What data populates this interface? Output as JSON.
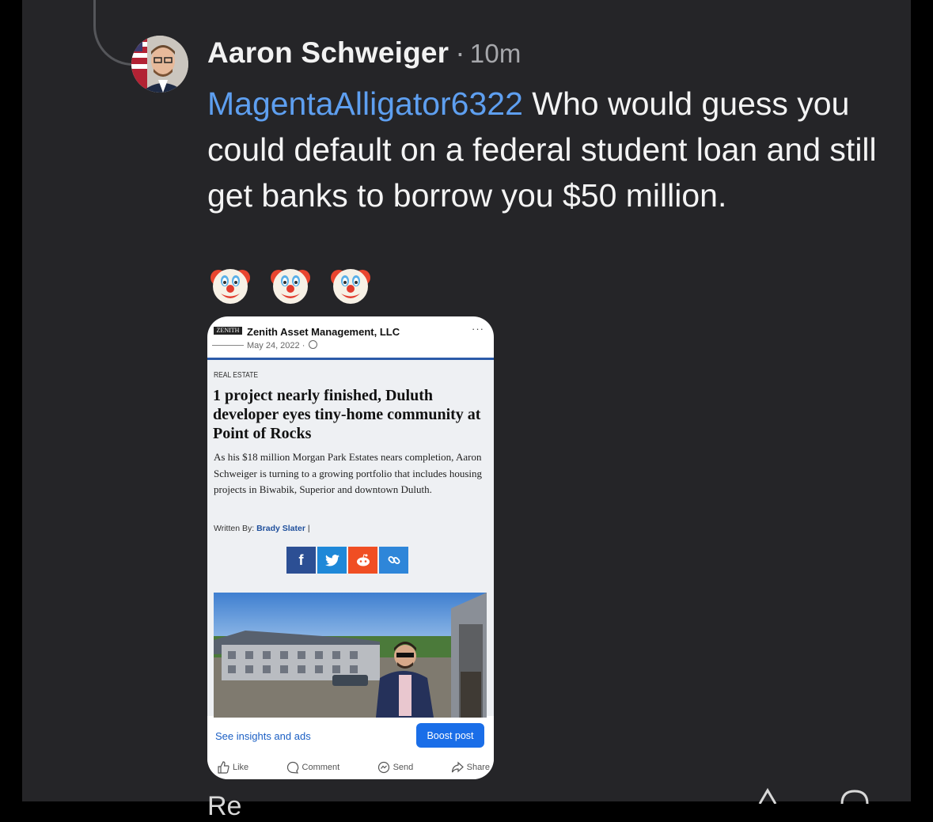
{
  "comment": {
    "author": "Aaron Schweiger",
    "separator": "·",
    "timestamp": "10m",
    "mention": "MagentaAlligator6322",
    "body": " Who would guess you could default on a federal student loan and still get banks to borrow you $50 million.",
    "emojis": [
      "clown-face",
      "clown-face",
      "clown-face"
    ]
  },
  "embedded_post": {
    "logo_text": "ZENITH",
    "page_name": "Zenith Asset Management, LLC",
    "date": "May 24, 2022 ·",
    "more": "···",
    "article": {
      "kicker": "REAL ESTATE",
      "headline": "1 project nearly finished, Duluth developer eyes tiny-home community at Point of Rocks",
      "dek": "As his $18 million Morgan Park Estates nears completion, Aaron Schweiger is turning to a growing portfolio that includes housing projects in Biwabik, Superior and downtown Duluth.",
      "byline_prefix": "Written By:",
      "byline_name": "Brady Slater",
      "byline_sep": "|",
      "share_buttons": [
        {
          "icon": "facebook-icon",
          "label": "f",
          "color": "#2c4f94"
        },
        {
          "icon": "twitter-icon",
          "label": "t",
          "color": "#1e88d8"
        },
        {
          "icon": "reddit-icon",
          "label": "r",
          "color": "#f04e23"
        },
        {
          "icon": "link-icon",
          "label": "link",
          "color": "#2e86d9"
        }
      ]
    },
    "insights_link": "See insights and ads",
    "boost_button": "Boost post",
    "actions": [
      "Like",
      "Comment",
      "Send",
      "Share"
    ]
  },
  "footer": {
    "reply_label": "Re"
  },
  "colors": {
    "background": "#252528",
    "mention": "#5e9ff0",
    "boost": "#1a6ee8"
  }
}
